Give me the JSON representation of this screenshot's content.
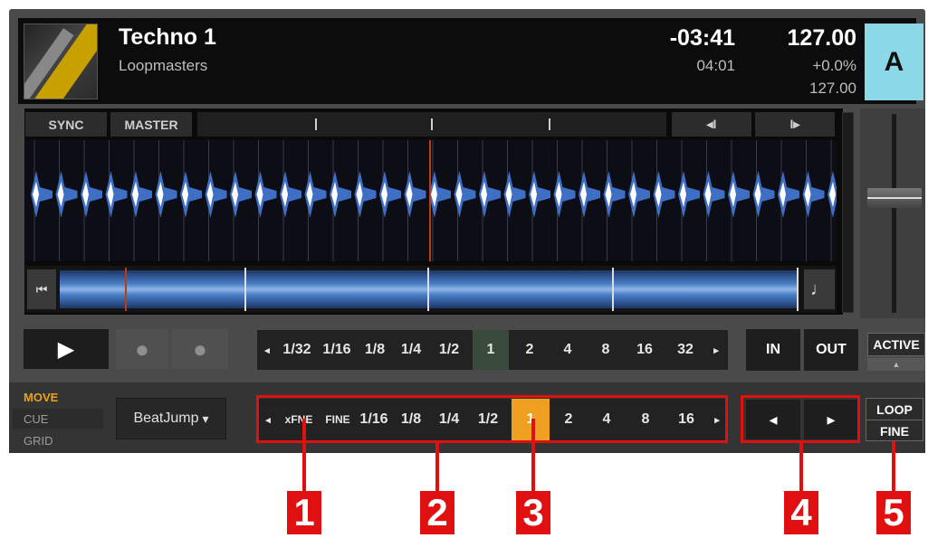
{
  "track": {
    "title": "Techno 1",
    "artist": "Loopmasters",
    "time_remaining": "-03:41",
    "time_total": "04:01",
    "bpm": "127.00",
    "pitch": "+0.0%",
    "bpm_original": "127.00",
    "deck_letter": "A"
  },
  "deck_controls": {
    "sync": "SYNC",
    "master": "MASTER",
    "nudge_left": "◂I",
    "nudge_right": "I▸",
    "back": "⏮",
    "note": "♩"
  },
  "transport": {
    "play": "▶",
    "cue_icon": "●",
    "vinyl_icon": "●"
  },
  "loop_sizes": {
    "left_arrow": "◂",
    "right_arrow": "▸",
    "items": [
      "1/32",
      "1/16",
      "1/8",
      "1/4",
      "1/2",
      "1",
      "2",
      "4",
      "8",
      "16",
      "32"
    ],
    "selected": "1"
  },
  "loop_io": {
    "in": "IN",
    "out": "OUT",
    "active": "ACTIVE",
    "active_arrow": "▲"
  },
  "modes": {
    "move": "MOVE",
    "cue": "CUE",
    "grid": "GRID"
  },
  "move_mode": {
    "value": "BeatJump",
    "arrow": "▾"
  },
  "jump_sizes": {
    "left_arrow": "◂",
    "right_arrow": "▸",
    "items": [
      "xFNE",
      "FINE",
      "1/16",
      "1/8",
      "1/4",
      "1/2",
      "1",
      "2",
      "4",
      "8",
      "16"
    ],
    "selected": "1"
  },
  "move_buttons": {
    "back": "◂",
    "forward": "▸"
  },
  "loop_fine": {
    "top": "LOOP",
    "bottom": "FINE"
  },
  "callouts": [
    "1",
    "2",
    "3",
    "4",
    "5"
  ],
  "colors": {
    "accent_orange": "#f0a020",
    "deck_blue": "#8ad8e8",
    "callout_red": "#e01010",
    "selected_green": "#3a4a3a"
  }
}
